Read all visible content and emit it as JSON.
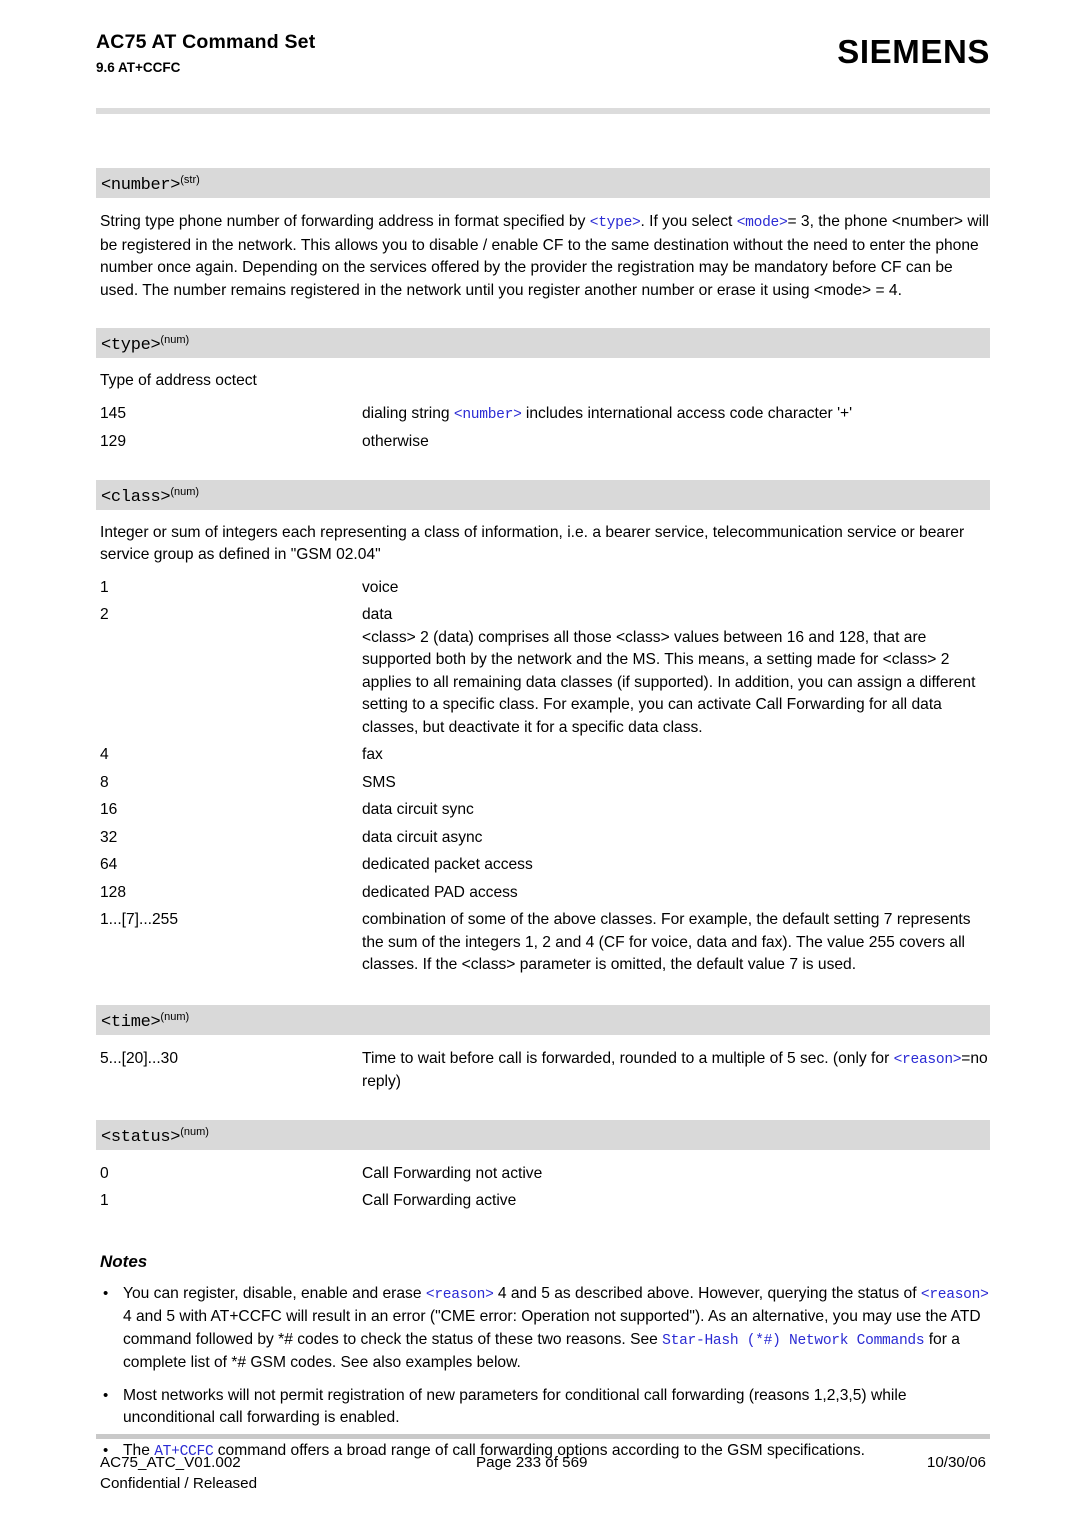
{
  "header": {
    "title": "AC75 AT Command Set",
    "subtitle": "9.6 AT+CCFC",
    "brand": "SIEMENS"
  },
  "colors": {
    "code_blue": "#2b2bd4",
    "band_gray": "#d9d9d9",
    "rule_gray": "#dcdcdc"
  },
  "sections": {
    "number": {
      "name": "<number>",
      "sup": "(str)",
      "body_1": "String type phone number of forwarding address in format specified by ",
      "ref_type": "<type>",
      "body_2": ". If you select ",
      "ref_mode": "<mode>",
      "body_3": "= 3, the phone <number> will be registered in the network. This allows you to disable / enable CF to the same destination without the need to enter the phone number once again. Depending on the services offered by the provider the registration may be mandatory before CF can be used. The number remains registered in the network until you register another number or erase it using <mode> = 4."
    },
    "type": {
      "name": "<type>",
      "sup": "(num)",
      "intro": "Type of address octect",
      "rows": [
        {
          "key": "145",
          "val_pre": "dialing string ",
          "val_ref": "<number>",
          "val_post": " includes international access code character '+'"
        },
        {
          "key": "129",
          "val_pre": "otherwise",
          "val_ref": "",
          "val_post": ""
        }
      ]
    },
    "class": {
      "name": "<class>",
      "sup": "(num)",
      "intro": "Integer or sum of integers each representing a class of information, i.e. a bearer service, telecommunication service or bearer service group as defined in \"GSM 02.04\"",
      "rows": [
        {
          "key": "1",
          "val": "voice",
          "extra": ""
        },
        {
          "key": "2",
          "val": "data",
          "extra": "<class> 2 (data) comprises all those <class> values between 16 and 128, that are supported both by the network and the MS. This means, a setting made for <class> 2 applies to all remaining data classes (if supported). In addition, you can assign a different setting to a specific class. For example, you can activate Call Forwarding for all data classes, but deactivate it for a specific data class."
        },
        {
          "key": "4",
          "val": "fax",
          "extra": ""
        },
        {
          "key": "8",
          "val": "SMS",
          "extra": ""
        },
        {
          "key": "16",
          "val": "data circuit sync",
          "extra": ""
        },
        {
          "key": "32",
          "val": "data circuit async",
          "extra": ""
        },
        {
          "key": "64",
          "val": "dedicated packet access",
          "extra": ""
        },
        {
          "key": "128",
          "val": "dedicated PAD access",
          "extra": ""
        },
        {
          "key": "1...[7]...255",
          "val": "combination of some of the above classes. For example, the default setting 7 represents the sum of the integers 1, 2 and 4 (CF for voice, data and fax). The value 255 covers all classes. If the <class> parameter is omitted, the default value 7 is used.",
          "extra": ""
        }
      ]
    },
    "time": {
      "name": "<time>",
      "sup": "(num)",
      "row_key": "5...[20]...30",
      "row_val_pre": "Time to wait before call is forwarded, rounded to a multiple of 5 sec. (only for ",
      "row_val_ref": "<reason>",
      "row_val_post": "=no reply)"
    },
    "status": {
      "name": "<status>",
      "sup": "(num)",
      "rows": [
        {
          "key": "0",
          "val": "Call Forwarding not active"
        },
        {
          "key": "1",
          "val": "Call Forwarding active"
        }
      ]
    }
  },
  "notes": {
    "heading": "Notes",
    "items": [
      {
        "seg1": "You can register, disable, enable and erase ",
        "ref1": "<reason>",
        "seg2": " 4 and 5 as described above. However, querying the status of ",
        "ref2": "<reason>",
        "seg3": " 4 and 5 with AT+CCFC will result in an error (\"CME error: Operation not supported\"). As an alternative, you may use the ATD command followed by *# codes to check the status of these two reasons. See ",
        "link": "Star-Hash (*#) Network Commands",
        "seg4": " for a complete list of *# GSM codes. See also examples below."
      },
      {
        "seg1": "Most networks will not permit registration of new parameters for conditional call forwarding (reasons 1,2,3,5) while unconditional call forwarding is enabled.",
        "ref1": "",
        "seg2": "",
        "ref2": "",
        "seg3": "",
        "link": "",
        "seg4": ""
      },
      {
        "seg1": "The ",
        "ref1": "AT+CCFC",
        "seg2": " command offers a broad range of call forwarding options according to the GSM specifications.",
        "ref2": "",
        "seg3": "",
        "link": "",
        "seg4": ""
      }
    ]
  },
  "footer": {
    "doc_id": "AC75_ATC_V01.002",
    "classification": "Confidential / Released",
    "page": "Page 233 of 569",
    "date": "10/30/06"
  }
}
